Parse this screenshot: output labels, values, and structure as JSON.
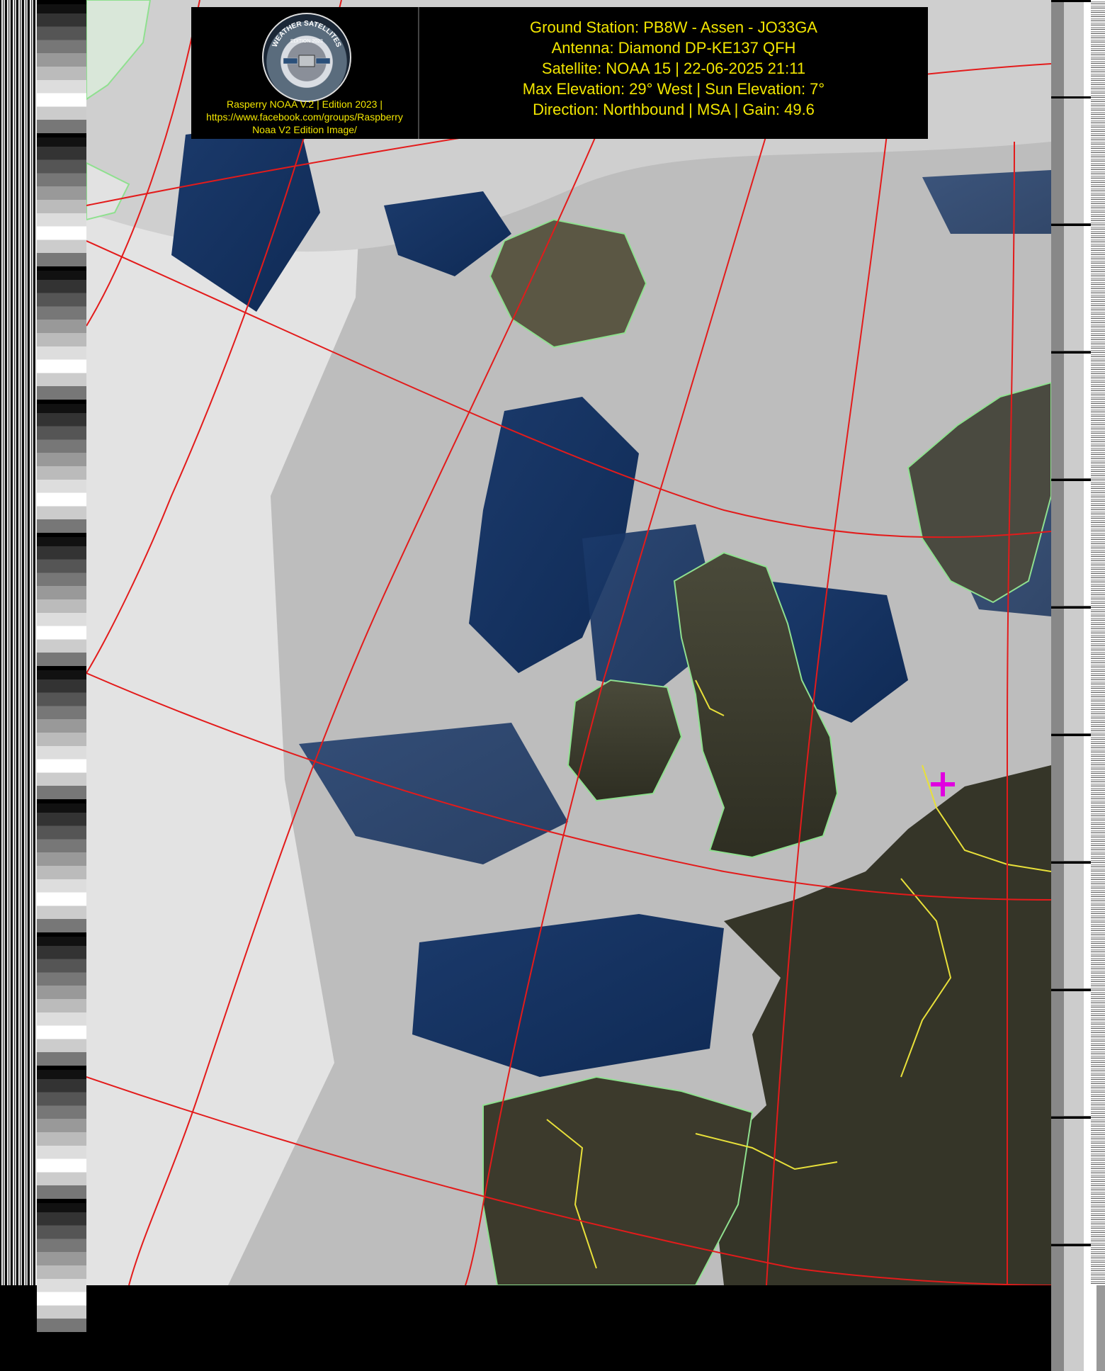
{
  "header": {
    "logo_text": "WEATHER SATELLITES",
    "logo_edition": "EDITION 2023",
    "caption_line1": "Rasperry NOAA V.2 | Edition 2023 |",
    "caption_line2": "https://www.facebook.com/groups/Raspberry",
    "caption_line3": "Noaa V2 Edition Image/",
    "info": [
      "Ground Station: PB8W - Assen - JO33GA",
      "Antenna: Diamond DP-KE137 QFH",
      "Satellite: NOAA 15 | 22-06-2025 21:11",
      "Max Elevation: 29° West | Sun Elevation: 7°",
      " Direction: Northbound | MSA | Gain: 49.6"
    ]
  },
  "map": {
    "graticule_color": "#e31b1b",
    "coast_color": "#8fe08f",
    "border_color": "#e8e03a",
    "marker_color": "#e000e0",
    "marker_icon": "plus-icon"
  }
}
